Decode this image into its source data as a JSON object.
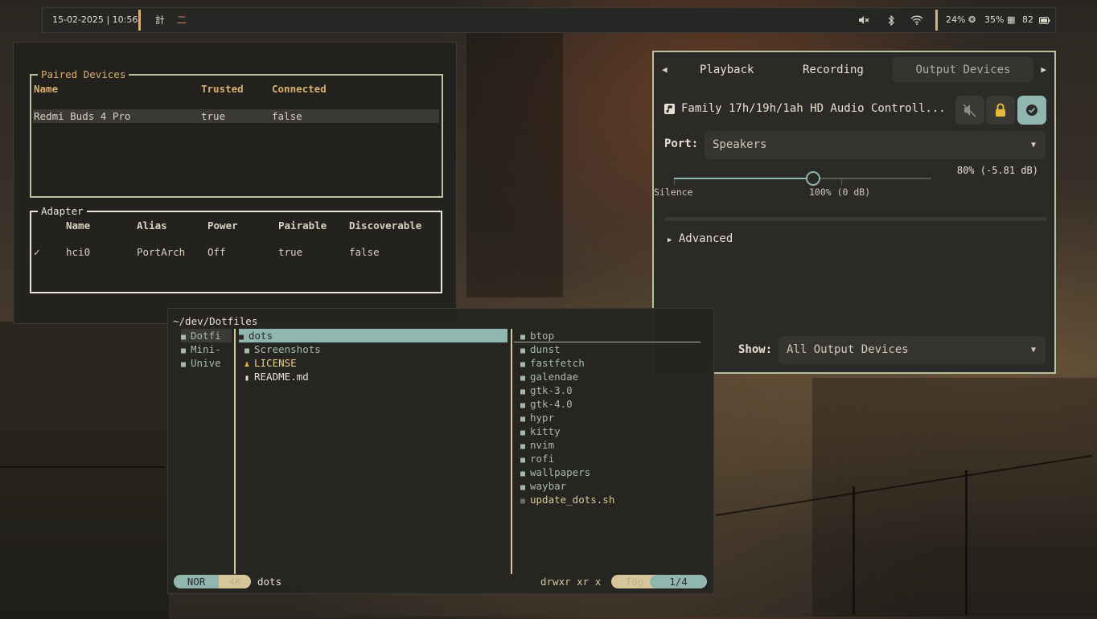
{
  "topbar": {
    "datetime": "15-02-2025",
    "time": "| 10:56",
    "workspace_icon_1": "計",
    "workspace_icon_2": "二",
    "volume_icon": "speaker-muted-icon",
    "bt_icon": "bluetooth-icon",
    "wifi_icon": "wifi-icon",
    "cpu": "24%",
    "mem": "35%",
    "battery": "82"
  },
  "bluetooth": {
    "paired_title": "Paired Devices",
    "paired_headers": [
      "Name",
      "Trusted",
      "Connected"
    ],
    "paired_rows": [
      {
        "name": "Redmi Buds 4 Pro",
        "trusted": "true",
        "connected": "false"
      }
    ],
    "adapter_title": "Adapter",
    "adapter_headers": [
      "Name",
      "Alias",
      "Power",
      "Pairable",
      "Discoverable"
    ],
    "adapter_rows": [
      {
        "check": "✓",
        "name": "hci0",
        "alias": "PortArch",
        "power": "Off",
        "pairable": "true",
        "discoverable": "false"
      }
    ]
  },
  "pavucontrol": {
    "tabs": [
      "Playback",
      "Recording",
      "Output Devices"
    ],
    "active_tab": "Output Devices",
    "device_name": "Family 17h/19h/1ah HD Audio Controll...",
    "port_label": "Port:",
    "port_value": "Speakers",
    "volume_readout": "80% (-5.81 dB)",
    "volume_fraction": 0.54,
    "label_silence": "Silence",
    "label_100": "100% (0 dB)",
    "advanced_label": "Advanced",
    "show_label": "Show:",
    "show_value": "All Output Devices"
  },
  "yazi": {
    "cwd": "~/dev/Dotfiles",
    "parent": [
      "Dotfi",
      "Mini-",
      "Unive"
    ],
    "current": [
      {
        "name": "dots",
        "type": "dir",
        "selected": true
      },
      {
        "name": "Screenshots",
        "type": "dir"
      },
      {
        "name": "LICENSE",
        "type": "license"
      },
      {
        "name": "README.md",
        "type": "file"
      }
    ],
    "preview": [
      "btop",
      "dunst",
      "fastfetch",
      "galendae",
      "gtk-3.0",
      "gtk-4.0",
      "hypr",
      "kitty",
      "nvim",
      "rofi",
      "wallpapers",
      "waybar",
      "update_dots.sh"
    ],
    "mode": "NOR",
    "size": "4K",
    "selected_name": "dots",
    "perms": "drwxr xr x",
    "position": "Top",
    "count": "1/4"
  },
  "colors": {
    "accent": "#b7c3a0",
    "teal": "#8fb7b0",
    "sand": "#d8b070",
    "dir": "#a6b8b0"
  }
}
